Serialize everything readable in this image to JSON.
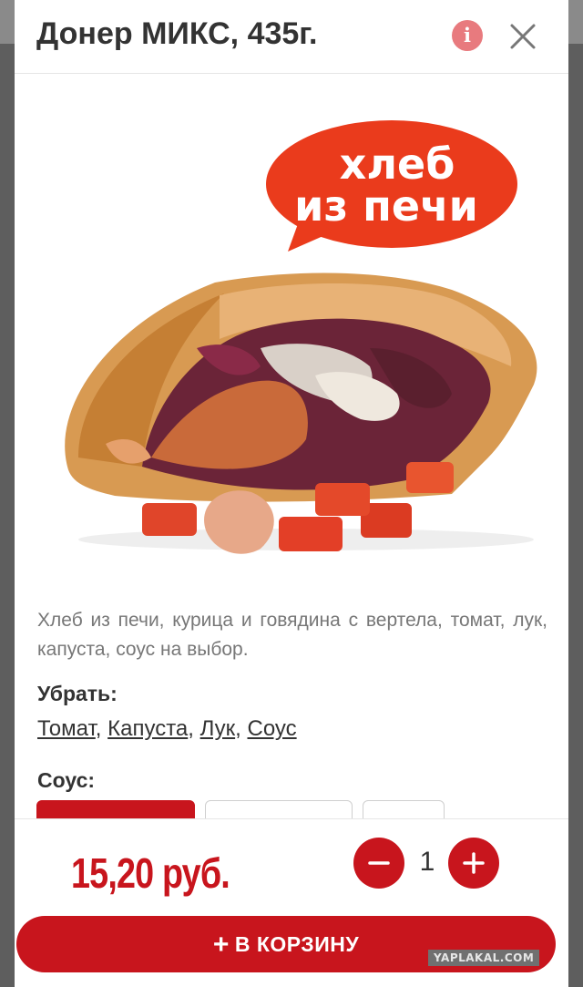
{
  "product": {
    "title": "Донер МИКС, 435г.",
    "badge_text": "хлеб из печи",
    "description": "Хлеб из печи, курица и говядина с вертела, томат, лук, капуста, соус на выбор."
  },
  "header": {
    "info_icon": "info-icon",
    "close_icon": "close-icon"
  },
  "remove_section": {
    "label": "Убрать:",
    "items": [
      "Томат",
      "Капуста",
      "Лук",
      "Соус"
    ]
  },
  "sauce_section": {
    "label": "Соус:",
    "selected_index": 0
  },
  "footer": {
    "price": "15,20 руб.",
    "quantity": "1",
    "add_to_cart": "В КОРЗИНУ"
  },
  "watermark": "YAPLAKAL.COM",
  "colors": {
    "accent": "#c8151d",
    "info": "#e87a7e",
    "text": "#333333",
    "muted": "#777777"
  }
}
